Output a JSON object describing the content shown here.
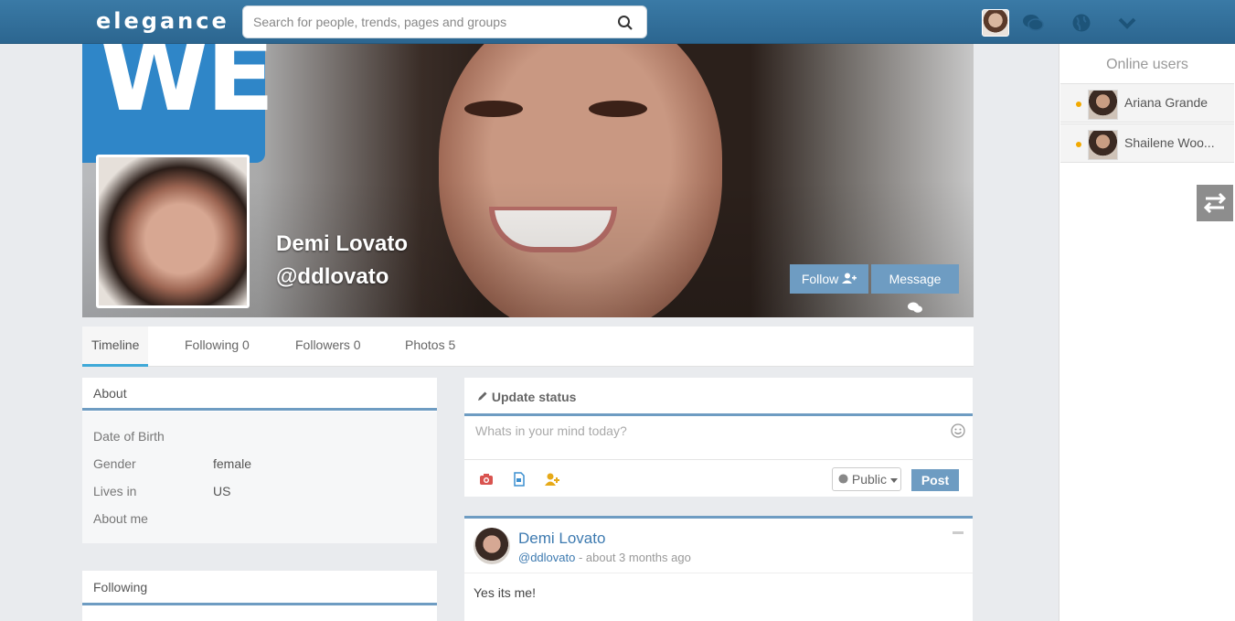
{
  "header": {
    "brand": "elegance",
    "search_placeholder": "Search for people, trends, pages and groups"
  },
  "online": {
    "title": "Online users",
    "users": [
      {
        "name": "Ariana Grande"
      },
      {
        "name": "Shailene Woo..."
      }
    ]
  },
  "profile": {
    "name": "Demi Lovato",
    "handle": "@ddlovato",
    "follow_label": "Follow",
    "message_label": "Message"
  },
  "tabs": [
    {
      "label": "Timeline"
    },
    {
      "label": "Following 0"
    },
    {
      "label": "Followers 0"
    },
    {
      "label": "Photos 5"
    }
  ],
  "about": {
    "title": "About",
    "rows": [
      {
        "label": "Date of Birth",
        "value": ""
      },
      {
        "label": "Gender",
        "value": "female"
      },
      {
        "label": "Lives in",
        "value": "US"
      },
      {
        "label": "About me",
        "value": ""
      }
    ]
  },
  "following": {
    "title": "Following"
  },
  "status": {
    "title": "Update status",
    "placeholder": "Whats in your mind today?",
    "privacy": "Public",
    "post_label": "Post"
  },
  "post": {
    "author": "Demi Lovato",
    "handle": "@ddlovato",
    "time": " - about 3 months ago",
    "text": "Yes its me!"
  },
  "colors": {
    "accent": "#6e9cc2",
    "topbar": "#2c6690",
    "link": "#3d7ab0",
    "online_dot": "#f2a900"
  }
}
